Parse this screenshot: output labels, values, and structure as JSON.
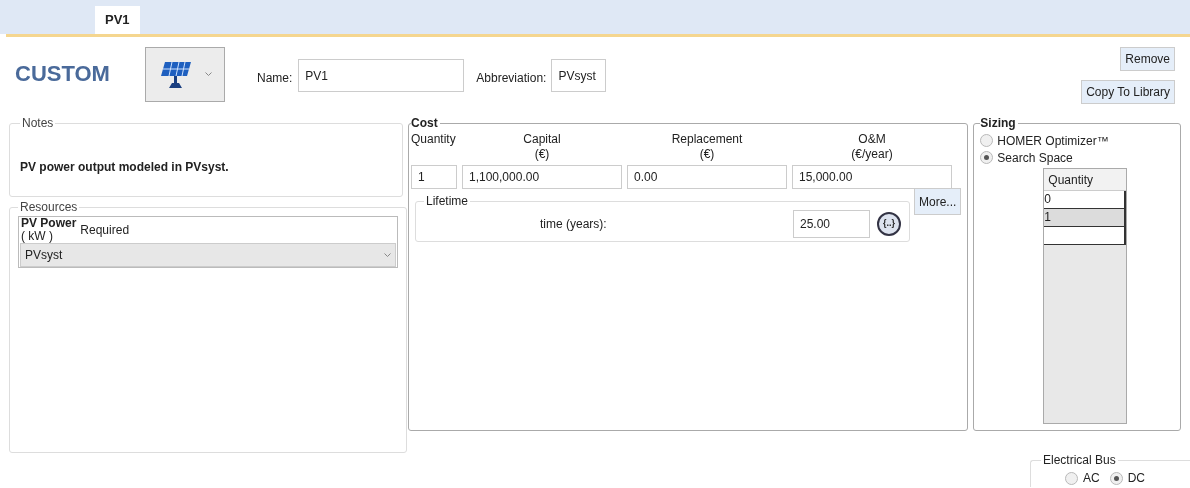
{
  "tabs": [
    {
      "label": "PV1",
      "selected": true
    }
  ],
  "header": {
    "brand": "CUSTOM",
    "name_label": "Name:",
    "name_value": "PV1",
    "abbreviation_label": "Abbreviation:",
    "abbreviation_value": "PVsyst",
    "buttons": [
      "Remove",
      "Copy To Library"
    ]
  },
  "notes": {
    "title": "Notes",
    "text": "PV power output modeled in PVsyst."
  },
  "resources": {
    "title": "Resources",
    "resource_name": "PV Power",
    "unit": "( kW )",
    "requirement": "Required",
    "selected_value": "PVsyst"
  },
  "cost": {
    "title": "Cost",
    "columns": [
      {
        "label": "Quantity",
        "value": "1"
      },
      {
        "label": "Capital",
        "unit": "(€)",
        "value": "1,100,000.00"
      },
      {
        "label": "Replacement",
        "unit": "(€)",
        "value": "0.00"
      },
      {
        "label": "O&M",
        "unit": "(€/year)",
        "value": "15,000.00"
      }
    ],
    "lifetime": {
      "title": "Lifetime",
      "label": "time (years):",
      "value": "25.00",
      "sensitivity_button": "{..}"
    },
    "more_button": "More..."
  },
  "sizing": {
    "title": "Sizing",
    "options": [
      {
        "label": "HOMER Optimizer™",
        "selected": false
      },
      {
        "label": "Search Space",
        "selected": true
      }
    ],
    "table": {
      "column": "Quantity",
      "rows": [
        {
          "value": "0",
          "selected": false
        },
        {
          "value": "1",
          "selected": true
        },
        {
          "value": "",
          "selected": false
        }
      ]
    }
  },
  "electrical_bus": {
    "title": "Electrical Bus",
    "options": [
      {
        "label": "AC",
        "selected": false
      },
      {
        "label": "DC",
        "selected": true
      }
    ]
  }
}
